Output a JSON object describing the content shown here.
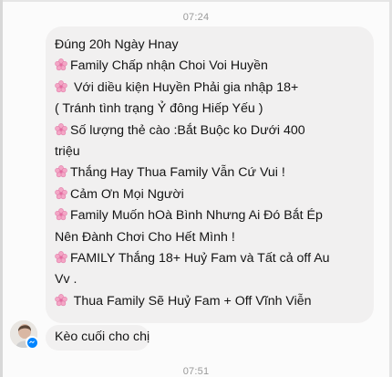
{
  "timestamps": {
    "top": "07:24",
    "bottom": "07:51"
  },
  "message_main": {
    "lines": [
      {
        "icon": "flower-emoji",
        "text": "",
        "first_text": "Đúng 20h Ngày Hnay"
      },
      {
        "icon": "flower-emoji",
        "text": "Family Chấp nhận Choi Voi  Huyền"
      },
      {
        "icon": "flower-emoji",
        "text": " Với diều kiện Huyền Phải gia nhập 18+"
      },
      {
        "icon": "none",
        "text": "( Tránh tình trạng Ỷ đông Hiếp Yếu )"
      },
      {
        "icon": "flower-emoji",
        "text": "Số lượng thẻ cào :Bắt Buộc ko Dưới  400"
      },
      {
        "icon": "none",
        "text": "triệu"
      },
      {
        "icon": "flower-emoji",
        "text": "Thắng Hay Thua Family Vẫn Cứ Vui !"
      },
      {
        "icon": "flower-emoji",
        "text": "Cảm Ơn Mọi Người"
      },
      {
        "icon": "flower-emoji",
        "text": "Family Muốn hOà Bình Nhưng Ai Đó Bắt Ép"
      },
      {
        "icon": "none",
        "text": "Nên Đành Chơi Cho Hết Mình !"
      },
      {
        "icon": "flower-emoji",
        "text": "FAMILY Thắng 18+ Huỷ Fam và Tất cả off Au"
      },
      {
        "icon": "none",
        "text": "Vv ."
      },
      {
        "icon": "flower-emoji",
        "text": " Thua Family Sẽ Huỷ Fam + Off Vĩnh Viễn"
      }
    ]
  },
  "message_small": {
    "text": "Kèo cuối cho chị"
  },
  "colors": {
    "bubble": "#f1f0f0",
    "messenger_badge": "#0084ff",
    "timestamp": "#9a9a9a"
  },
  "icons": {
    "flower": "cherry-blossom-icon",
    "avatar": "avatar",
    "badge": "messenger-icon"
  }
}
